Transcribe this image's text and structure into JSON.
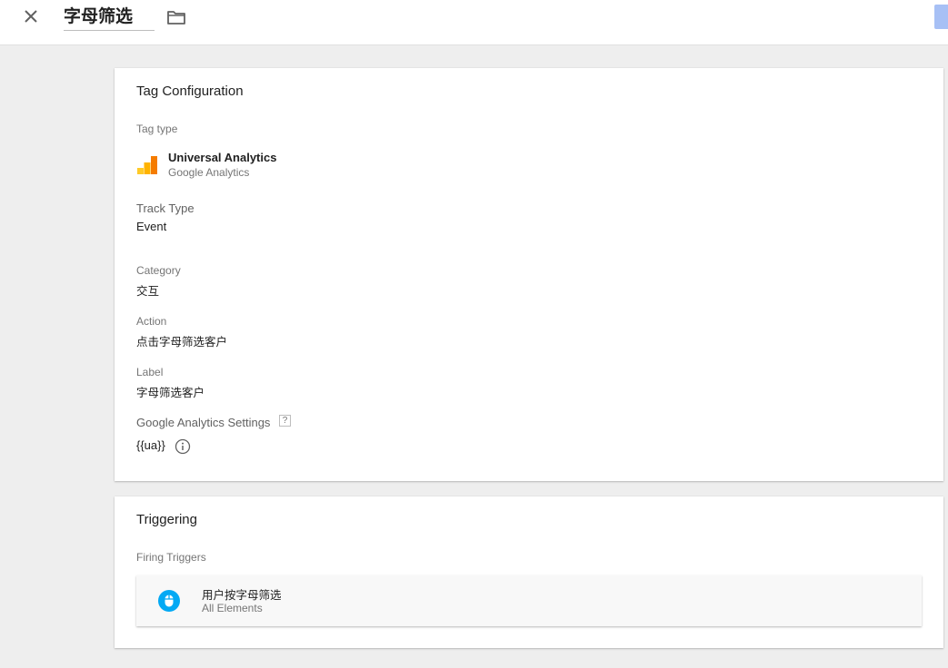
{
  "header": {
    "title": "字母筛选"
  },
  "tag_config": {
    "title": "Tag Configuration",
    "tag_type_label": "Tag type",
    "tag_type_name": "Universal Analytics",
    "tag_type_vendor": "Google Analytics",
    "track_type_label": "Track Type",
    "track_type_value": "Event",
    "category_label": "Category",
    "category_value": "交互",
    "action_label": "Action",
    "action_value": "点击字母筛选客户",
    "label_label": "Label",
    "label_value": "字母筛选客户",
    "ga_settings_label": "Google Analytics Settings",
    "ga_settings_help": "?",
    "ga_settings_value": "{{ua}}"
  },
  "triggering": {
    "title": "Triggering",
    "firing_label": "Firing Triggers",
    "trigger_name": "用户按字母筛选",
    "trigger_type": "All Elements"
  },
  "icons": {
    "close": "close-icon",
    "folder": "folder-icon",
    "ga_logo": "google-analytics-logo-icon",
    "info": "info-icon",
    "trigger": "mouse-click-icon"
  },
  "colors": {
    "accent_blue": "#a7c0f5",
    "trigger_icon": "#03a9f4",
    "ga_orange": "#f57c00",
    "ga_yellow": "#ffb300"
  }
}
